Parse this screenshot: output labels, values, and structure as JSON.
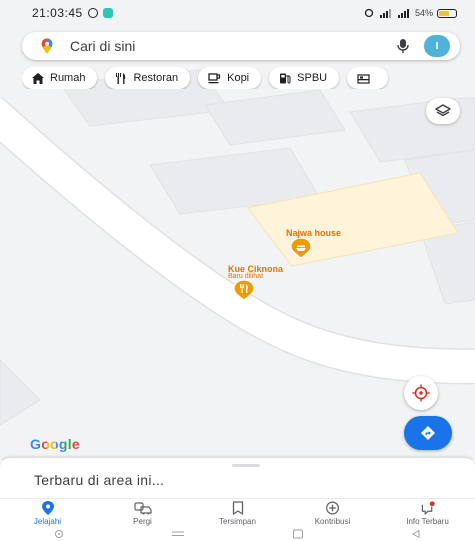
{
  "status_bar": {
    "time": "21:03:45",
    "battery": "54%"
  },
  "search": {
    "placeholder": "Cari di sini",
    "avatar_initial": "I"
  },
  "chips": [
    {
      "label": "Rumah",
      "icon": "home-icon"
    },
    {
      "label": "Restoran",
      "icon": "restaurant-icon"
    },
    {
      "label": "Kopi",
      "icon": "coffee-icon"
    },
    {
      "label": "SPBU",
      "icon": "gas-station-icon"
    },
    {
      "label": "",
      "icon": "hotel-icon"
    }
  ],
  "map": {
    "pois": [
      {
        "name": "Najwa house",
        "sublabel": ""
      },
      {
        "name": "Kue Ciknona",
        "sublabel": "Baru dilihat"
      }
    ],
    "logo": "Google"
  },
  "sheet": {
    "title": "Terbaru di area ini..."
  },
  "bottom_nav": [
    {
      "label": "Jelajahi",
      "icon": "explore-pin-icon",
      "active": true
    },
    {
      "label": "Pergi",
      "icon": "commute-icon",
      "active": false
    },
    {
      "label": "Tersimpan",
      "icon": "bookmark-icon",
      "active": false
    },
    {
      "label": "Kontribusi",
      "icon": "add-circle-icon",
      "active": false
    },
    {
      "label": "Info Terbaru",
      "icon": "updates-icon",
      "active": false
    }
  ],
  "colors": {
    "accent": "#1a73e8",
    "poi": "#e37400",
    "map_bg": "#f1f3f4",
    "road": "#ffffff",
    "highlight_area": "#fdf4d9"
  }
}
